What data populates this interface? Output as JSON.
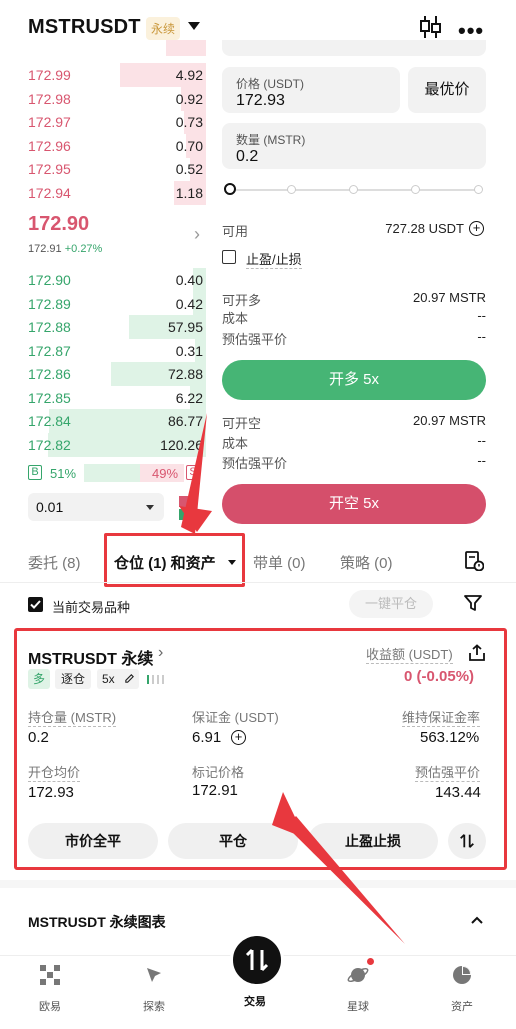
{
  "header": {
    "symbol": "MSTRUSDT",
    "badge": "永续"
  },
  "order_book": {
    "asks": [
      {
        "price": "172.99",
        "qty": "4.92",
        "depth": 0.48
      },
      {
        "price": "172.98",
        "qty": "0.92",
        "depth": 0.14
      },
      {
        "price": "172.97",
        "qty": "0.73",
        "depth": 0.12
      },
      {
        "price": "172.96",
        "qty": "0.70",
        "depth": 0.11
      },
      {
        "price": "172.95",
        "qty": "0.52",
        "depth": 0.09
      },
      {
        "price": "172.94",
        "qty": "1.18",
        "depth": 0.18
      }
    ],
    "last_price": "172.90",
    "mark_line": "172.91",
    "change": "+0.27%",
    "bids": [
      {
        "price": "172.90",
        "qty": "0.40",
        "depth": 0.07
      },
      {
        "price": "172.89",
        "qty": "0.42",
        "depth": 0.07
      },
      {
        "price": "172.88",
        "qty": "57.95",
        "depth": 0.43
      },
      {
        "price": "172.87",
        "qty": "0.31",
        "depth": 0.06
      },
      {
        "price": "172.86",
        "qty": "72.88",
        "depth": 0.53
      },
      {
        "price": "172.85",
        "qty": "6.22",
        "depth": 0.09
      },
      {
        "price": "172.84",
        "qty": "86.77",
        "depth": 0.87
      },
      {
        "price": "172.82",
        "qty": "120.26",
        "depth": 0.88
      }
    ],
    "buy_ratio_label": "B",
    "buy_ratio": "51%",
    "sell_ratio": "49%",
    "sell_ratio_label": "S",
    "depth_step": "0.01"
  },
  "form": {
    "price_label": "价格 (USDT)",
    "price_value": "172.93",
    "best_price_label": "最优价",
    "qty_label": "数量 (MSTR)",
    "qty_value": "0.2",
    "available_label": "可用",
    "available_value": "727.28 USDT",
    "tpsl_label": "止盈/止损",
    "can_open_long_label": "可开多",
    "can_open_long_value": "20.97 MSTR",
    "cost_label": "成本",
    "cost_value": "--",
    "est_liq_label": "预估强平价",
    "est_liq_value": "--",
    "open_long_button": "开多 5x",
    "can_open_short_label": "可开空",
    "can_open_short_value": "20.97 MSTR",
    "cost_label_2": "成本",
    "cost_value_2": "--",
    "est_liq_label_2": "预估强平价",
    "est_liq_value_2": "--",
    "open_short_button": "开空 5x"
  },
  "tabs": {
    "orders": "委托 (8)",
    "positions": "仓位 (1) 和资产",
    "trailing": "带单 (0)",
    "strategy": "策略 (0)"
  },
  "filter_bar": {
    "current_only_label": "当前交易品种",
    "close_all_button": "一键平仓"
  },
  "position": {
    "title": "MSTRUSDT 永续",
    "side_tag": "多",
    "margin_mode_tag": "逐仓",
    "leverage_tag": "5x",
    "pnl_label": "收益额 (USDT)",
    "pnl_value": "0 (-0.05%)",
    "size_label": "持仓量 (MSTR)",
    "size_value": "0.2",
    "margin_label": "保证金 (USDT)",
    "margin_value": "6.91",
    "maint_margin_rate_label": "维持保证金率",
    "maint_margin_rate_value": "563.12%",
    "entry_label": "开仓均价",
    "entry_value": "172.93",
    "mark_label": "标记价格",
    "mark_value": "172.91",
    "liq_label": "预估强平价",
    "liq_value": "143.44",
    "market_close_button": "市价全平",
    "close_button": "平仓",
    "tpsl_button": "止盈止损"
  },
  "chart_section": {
    "title": "MSTRUSDT 永续图表"
  },
  "bottom_nav": {
    "items": [
      "欧易",
      "探索",
      "交易",
      "星球",
      "资产"
    ]
  },
  "colors": {
    "bid": "#35a56b",
    "ask": "#d8566f",
    "annotation": "#e8383e"
  }
}
